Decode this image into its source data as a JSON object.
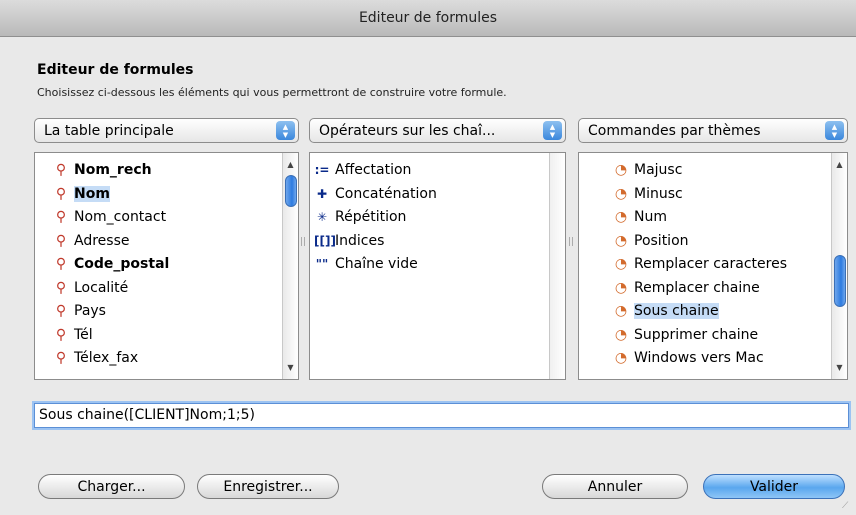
{
  "window": {
    "title": "Editeur de formules"
  },
  "header": {
    "title": "Editeur de formules",
    "subtitle": "Choisissez ci-dessous les éléments qui vous permettront de construire votre formule."
  },
  "popups": {
    "table": "La table principale",
    "operators": "Opérateurs sur les chaî...",
    "commands": "Commandes par thèmes"
  },
  "fields_list": {
    "icon": "field-icon",
    "items": [
      {
        "label": "Nom_rech",
        "bold": true,
        "selected": false
      },
      {
        "label": "Nom",
        "bold": true,
        "selected": true
      },
      {
        "label": "Nom_contact",
        "bold": false,
        "selected": false
      },
      {
        "label": "Adresse",
        "bold": false,
        "selected": false
      },
      {
        "label": "Code_postal",
        "bold": true,
        "selected": false
      },
      {
        "label": "Localité",
        "bold": false,
        "selected": false
      },
      {
        "label": "Pays",
        "bold": false,
        "selected": false
      },
      {
        "label": "Tél",
        "bold": false,
        "selected": false
      },
      {
        "label": "Télex_fax",
        "bold": false,
        "selected": false
      }
    ]
  },
  "operators_list": {
    "items": [
      {
        "symbol": ":=",
        "icon": "assignment-icon",
        "label": "Affectation"
      },
      {
        "symbol": "✚",
        "icon": "plus-icon",
        "label": "Concaténation"
      },
      {
        "symbol": "✳",
        "icon": "asterisk-icon",
        "label": "Répétition"
      },
      {
        "symbol": "[[]]",
        "icon": "brackets-icon",
        "label": "Indices"
      },
      {
        "symbol": "\"\"",
        "icon": "quotes-icon",
        "label": "Chaîne vide"
      }
    ]
  },
  "commands_list": {
    "icon": "command-icon",
    "items": [
      {
        "label": "Majusc",
        "selected": false
      },
      {
        "label": "Minusc",
        "selected": false
      },
      {
        "label": "Num",
        "selected": false
      },
      {
        "label": "Position",
        "selected": false
      },
      {
        "label": "Remplacer caracteres",
        "selected": false
      },
      {
        "label": "Remplacer chaine",
        "selected": false
      },
      {
        "label": "Sous chaine",
        "selected": true
      },
      {
        "label": "Supprimer chaine",
        "selected": false
      },
      {
        "label": "Windows vers Mac",
        "selected": false
      }
    ]
  },
  "formula": {
    "value": "Sous chaine([CLIENT]Nom;1;5)"
  },
  "buttons": {
    "load": "Charger...",
    "save": "Enregistrer...",
    "cancel": "Annuler",
    "ok": "Valider"
  },
  "colors": {
    "selection": "#c5dcf6",
    "accent": "#3b87dc",
    "field_icon": "#c0392b"
  }
}
